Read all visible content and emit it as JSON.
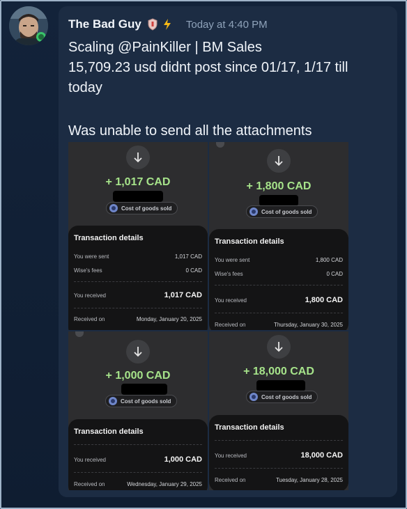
{
  "message": {
    "username": "The Bad Guy",
    "timestamp": "Today at 4:40 PM",
    "line1": "Scaling @PainKiller | BM Sales",
    "line2": "15,709.23 usd didnt post since 01/17, 1/17 till",
    "line3": "today",
    "line4": "Was unable to send all the attachments"
  },
  "attachments": [
    {
      "amount": "+ 1,017 CAD",
      "category": "Cost of goods sold",
      "title": "Transaction details",
      "sent_label": "You were sent",
      "sent_value": "1,017 CAD",
      "fees_label": "Wise's fees",
      "fees_value": "0 CAD",
      "received_label": "You received",
      "received_value": "1,017 CAD",
      "date_label": "Received on",
      "date_value": "Monday, January 20, 2025"
    },
    {
      "amount": "+ 1,800 CAD",
      "category": "Cost of goods sold",
      "title": "Transaction details",
      "sent_label": "You were sent",
      "sent_value": "1,800 CAD",
      "fees_label": "Wise's fees",
      "fees_value": "0 CAD",
      "received_label": "You received",
      "received_value": "1,800 CAD",
      "date_label": "Received on",
      "date_value": "Thursday, January 30, 2025"
    },
    {
      "amount": "+ 1,000 CAD",
      "category": "Cost of goods sold",
      "title": "Transaction details",
      "received_label": "You received",
      "received_value": "1,000 CAD",
      "date_label": "Received on",
      "date_value": "Wednesday, January 29, 2025"
    },
    {
      "amount": "+ 18,000 CAD",
      "category": "Cost of goods sold",
      "title": "Transaction details",
      "received_label": "You received",
      "received_value": "18,000 CAD",
      "date_label": "Received on",
      "date_value": "Tuesday, January 28, 2025"
    }
  ],
  "colors": {
    "background": "#13233a",
    "bubble": "#1c2c43",
    "amount_green": "#a6e38a",
    "card": "#141415"
  },
  "icons": [
    "avatar",
    "shield-badge-icon",
    "lightning-icon",
    "arrow-down-icon",
    "category-icon"
  ]
}
